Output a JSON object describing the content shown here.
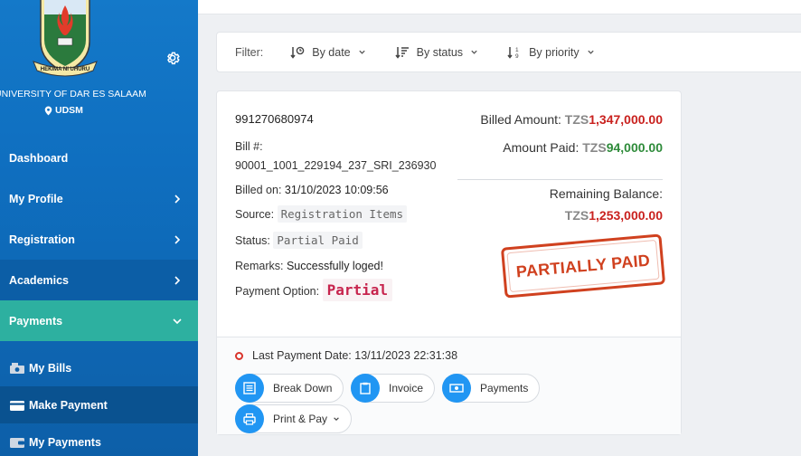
{
  "sidebar": {
    "university_name": "UNIVERSITY OF DAR ES SALAAM",
    "crest_motto": "HEKIMA NI UHURU",
    "campus": "UDSM",
    "nav": {
      "dashboard": "Dashboard",
      "profile": "My Profile",
      "registration": "Registration",
      "academics": "Academics",
      "payments": "Payments"
    },
    "sub": {
      "my_bills": "My Bills",
      "make_payment": "Make Payment",
      "my_payments": "My Payments"
    },
    "colors": {
      "sidebar": "#1479c9",
      "active": "#2db0a0",
      "selected": "#0a5290"
    }
  },
  "filter": {
    "label": "Filter:",
    "by_date": "By date",
    "by_status": "By status",
    "by_priority": "By priority"
  },
  "bill": {
    "number": "991270680974",
    "bill_no_label": "Bill #:",
    "bill_no_value": "90001_1001_229194_237_SRI_236930",
    "billed_on_label": "Billed on:",
    "billed_on_value": "31/10/2023 10:09:56",
    "source_label": "Source:",
    "source_value": "Registration Items",
    "status_label": "Status:",
    "status_value": "Partial Paid",
    "remarks_label": "Remarks:",
    "remarks_value": "Successfully loged!",
    "payment_option_label": "Payment Option:",
    "payment_option_value": "Partial",
    "billed_amount_label": "Billed Amount:",
    "currency": "TZS",
    "billed_amount": "1,347,000.00",
    "amount_paid_label": "Amount Paid:",
    "amount_paid": "94,000.00",
    "remaining_label": "Remaining Balance:",
    "remaining": "1,253,000.00",
    "stamp": "PARTIALLY PAID",
    "last_payment_label": "Last Payment Date:",
    "last_payment_value": "13/11/2023 22:31:38",
    "actions": {
      "breakdown": "Break Down",
      "invoice": "Invoice",
      "payments": "Payments",
      "print_pay": "Print & Pay"
    }
  }
}
